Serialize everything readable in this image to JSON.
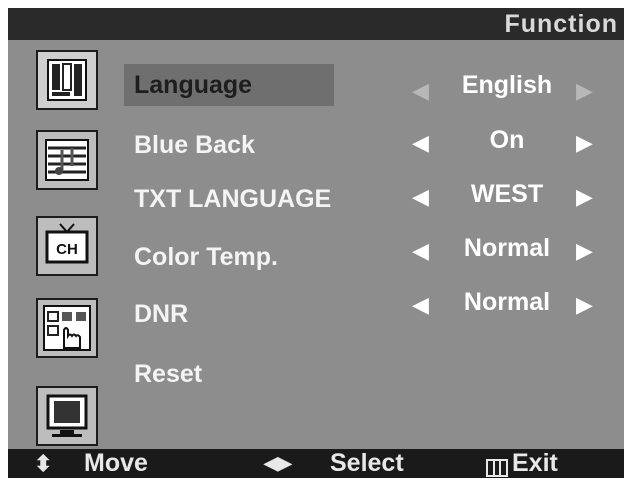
{
  "header": {
    "title": "Function"
  },
  "menu": {
    "items": [
      {
        "label": "Language",
        "value": "English",
        "selected": true
      },
      {
        "label": "Blue Back",
        "value": "On",
        "selected": false
      },
      {
        "label": "TXT LANGUAGE",
        "value": "WEST",
        "selected": false
      },
      {
        "label": "Color Temp.",
        "value": "Normal",
        "selected": false
      },
      {
        "label": "DNR",
        "value": "Normal",
        "selected": false
      },
      {
        "label": "Reset",
        "value": "",
        "selected": false
      }
    ]
  },
  "sidebar": {
    "icons": [
      {
        "name": "picture-icon"
      },
      {
        "name": "sound-icon"
      },
      {
        "name": "channel-icon",
        "label": "CH"
      },
      {
        "name": "function-icon"
      },
      {
        "name": "screen-icon"
      }
    ]
  },
  "footer": {
    "move_label": "Move",
    "select_label": "Select",
    "exit_label": "Exit"
  },
  "glyphs": {
    "left_arrow": "◀",
    "right_arrow": "▶",
    "up_down": "⬍"
  }
}
